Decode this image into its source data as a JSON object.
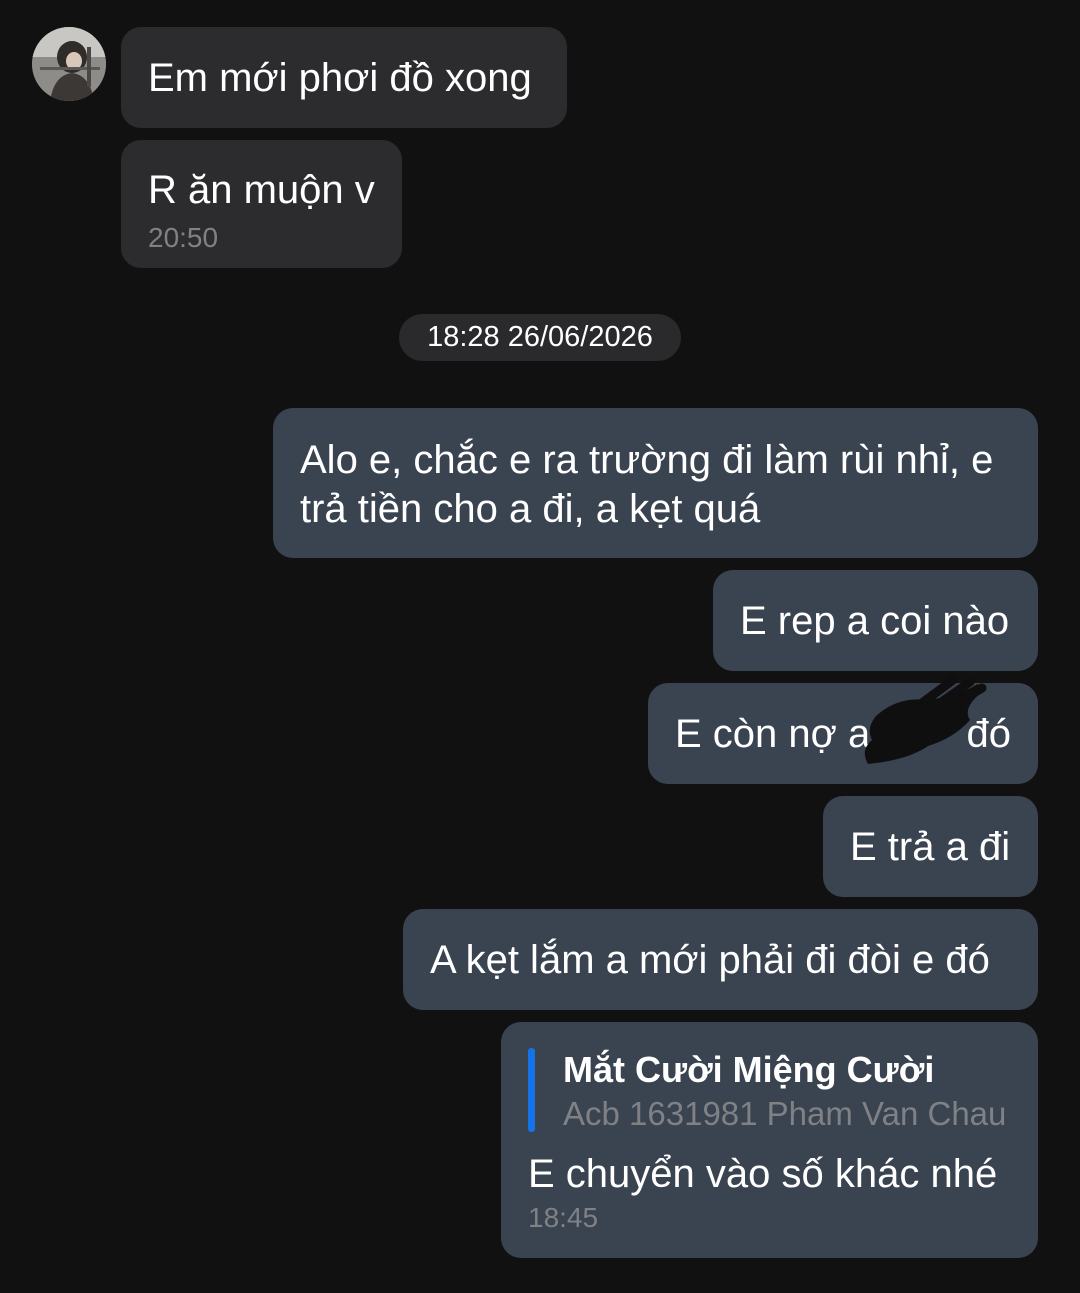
{
  "chat": {
    "incoming": [
      {
        "text": "Em mới phơi đồ xong"
      },
      {
        "text": "R ăn muộn v",
        "time": "20:50"
      }
    ],
    "date_separator": "18:28 26/06/2026",
    "outgoing": [
      {
        "lines": [
          "Alo e, chắc e ra trường đi làm rùi nhỉ, e",
          "trả tiền cho a đi, a kẹt quá"
        ]
      },
      {
        "text": "E rep a coi nào"
      },
      {
        "text": "E còn nợ a",
        "text_end": "đó"
      },
      {
        "text": "E trả a đi"
      },
      {
        "text": "A kẹt lắm a mới phải đi đòi e đó"
      },
      {
        "quote_title": "Mắt Cười Miệng Cười",
        "quote_body": "Acb 1631981 Pham Van Chau",
        "text": "E chuyển vào số khác nhé",
        "time": "18:45"
      }
    ]
  },
  "colors": {
    "background": "#111112",
    "incoming_bubble": "#2c2c2e",
    "outgoing_bubble": "#3a4350",
    "quote_accent": "#1473e6",
    "timestamp": "#7f8185"
  },
  "icons": {
    "avatar": "contact-avatar-photo",
    "redaction": "scribble-redaction"
  }
}
